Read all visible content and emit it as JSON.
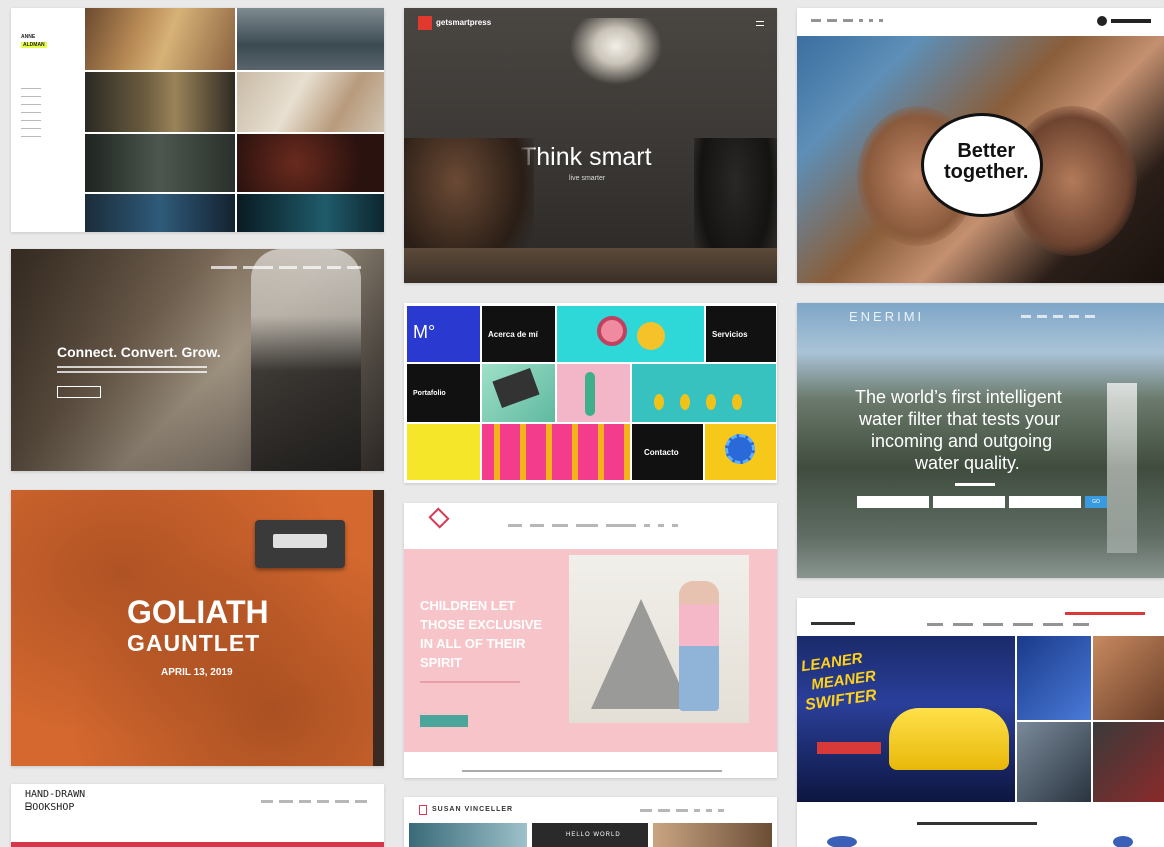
{
  "colors": {
    "page_bg": "#e9e9ea",
    "orange": "#d4682f",
    "pink": "#f7c5c9",
    "teal": "#4aa59a",
    "yellow_accent": "#e8ff4a"
  },
  "t1": {
    "logo_lines": [
      "ANNE",
      "ALDMAN"
    ]
  },
  "t2": {
    "brand": "getsmartpress",
    "headline": "Think smart",
    "sub": "live smarter"
  },
  "t3": {
    "badge": "Better\ntogether."
  },
  "t4": {
    "headline": "Connect. Convert. Grow."
  },
  "t5": {
    "cells": [
      "Acerca de mí",
      "Servicios",
      "Portafolio",
      "Contacto"
    ]
  },
  "t6": {
    "brand": "ENERIMI",
    "headline_lines": [
      "The world’s first intelligent",
      "water filter that tests your",
      "incoming and outgoing",
      "water quality."
    ],
    "button": "GO"
  },
  "t7": {
    "title_top": "GOLIATH",
    "title_bottom": "GAUNTLET",
    "date": "APRIL 13, 2019"
  },
  "t8": {
    "headline_lines": [
      "CHILDREN LET",
      "THOSE EXCLUSIVE",
      "IN ALL OF THEIR",
      "SPIRIT"
    ]
  },
  "t9": {
    "promo_lines": [
      "LEANER",
      "MEANER",
      "SWIFTER"
    ]
  },
  "t10": {
    "logo_lines": [
      "HAND-DRAWN",
      "ᗷOOKSHOP"
    ]
  },
  "t11": {
    "brand": "SUSAN VINCELLER",
    "banner": "HELLO WORLD"
  }
}
